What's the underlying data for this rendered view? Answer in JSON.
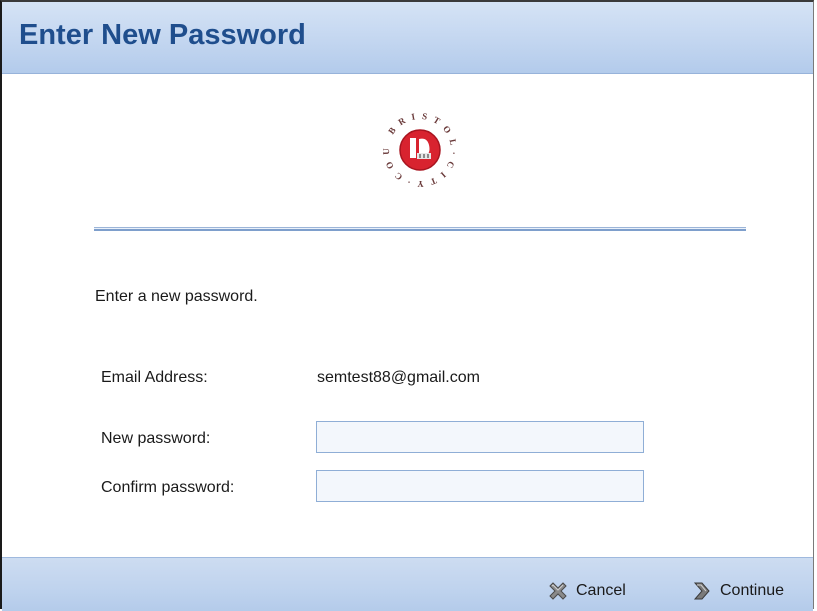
{
  "dialog": {
    "title": "Enter New Password",
    "logo": {
      "name": "bristol-city-council-logo",
      "ring_text": "BRISTOL CITY COUNCIL",
      "accent": "#c8202f"
    },
    "instruction": "Enter a new password."
  },
  "form": {
    "email_label": "Email Address:",
    "email_value": "semtest88@gmail.com",
    "new_password_label": "New password:",
    "new_password_value": "",
    "confirm_password_label": "Confirm password:",
    "confirm_password_value": ""
  },
  "footer": {
    "cancel_label": "Cancel",
    "cancel_icon": "cancel-x-icon",
    "continue_label": "Continue",
    "continue_icon": "chevron-right-icon"
  },
  "colors": {
    "title": "#1f4e8d",
    "header_gradient": "#c3d6f0",
    "footer_gradient": "#bfd3ee",
    "input_border": "#8faed6",
    "logo_red": "#c8202f"
  }
}
